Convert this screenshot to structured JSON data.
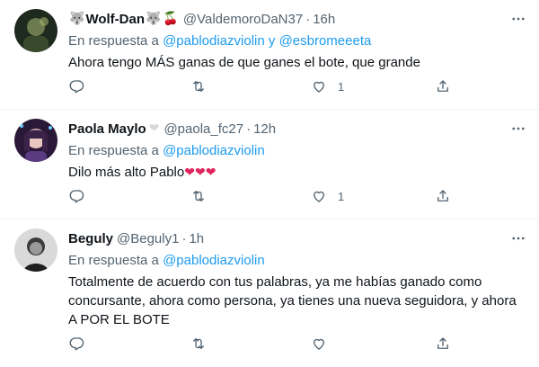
{
  "tweets": [
    {
      "name": "Wolf-Dan",
      "handle": "@ValdemoroDaN37",
      "time": "16h",
      "reply_prefix": "En respuesta a",
      "mentions": [
        "@pablodiazviolin",
        "@esbromeeeta"
      ],
      "mention_joiner": "y",
      "text": "Ahora tengo MÁS ganas de que ganes el bote, que grande",
      "likes": "1"
    },
    {
      "name": "Paola Maylo",
      "handle": "@paola_fc27",
      "time": "12h",
      "reply_prefix": "En respuesta a",
      "mentions": [
        "@pablodiazviolin"
      ],
      "text": "Dilo más alto Pablo",
      "likes": "1"
    },
    {
      "name": "Beguly",
      "handle": "@Beguly1",
      "time": "1h",
      "reply_prefix": "En respuesta a",
      "mentions": [
        "@pablodiazviolin"
      ],
      "text": "Totalmente de acuerdo con tus palabras, ya me habías ganado como concursante, ahora como persona, ya tienes una nueva seguidora, y ahora A POR EL BOTE",
      "likes": ""
    }
  ],
  "separator": "·",
  "colors": {
    "text": "#0f1419",
    "secondary": "#536471",
    "link": "#1d9bf0",
    "divider": "#eff3f4",
    "heart": "#e0245e"
  },
  "icons": [
    "reply-icon",
    "retweet-icon",
    "like-icon",
    "share-icon",
    "more-icon",
    "wolf-emoji-icon",
    "cherry-emoji-icon",
    "white-heart-emoji-icon",
    "red-heart-emoji-icon"
  ]
}
